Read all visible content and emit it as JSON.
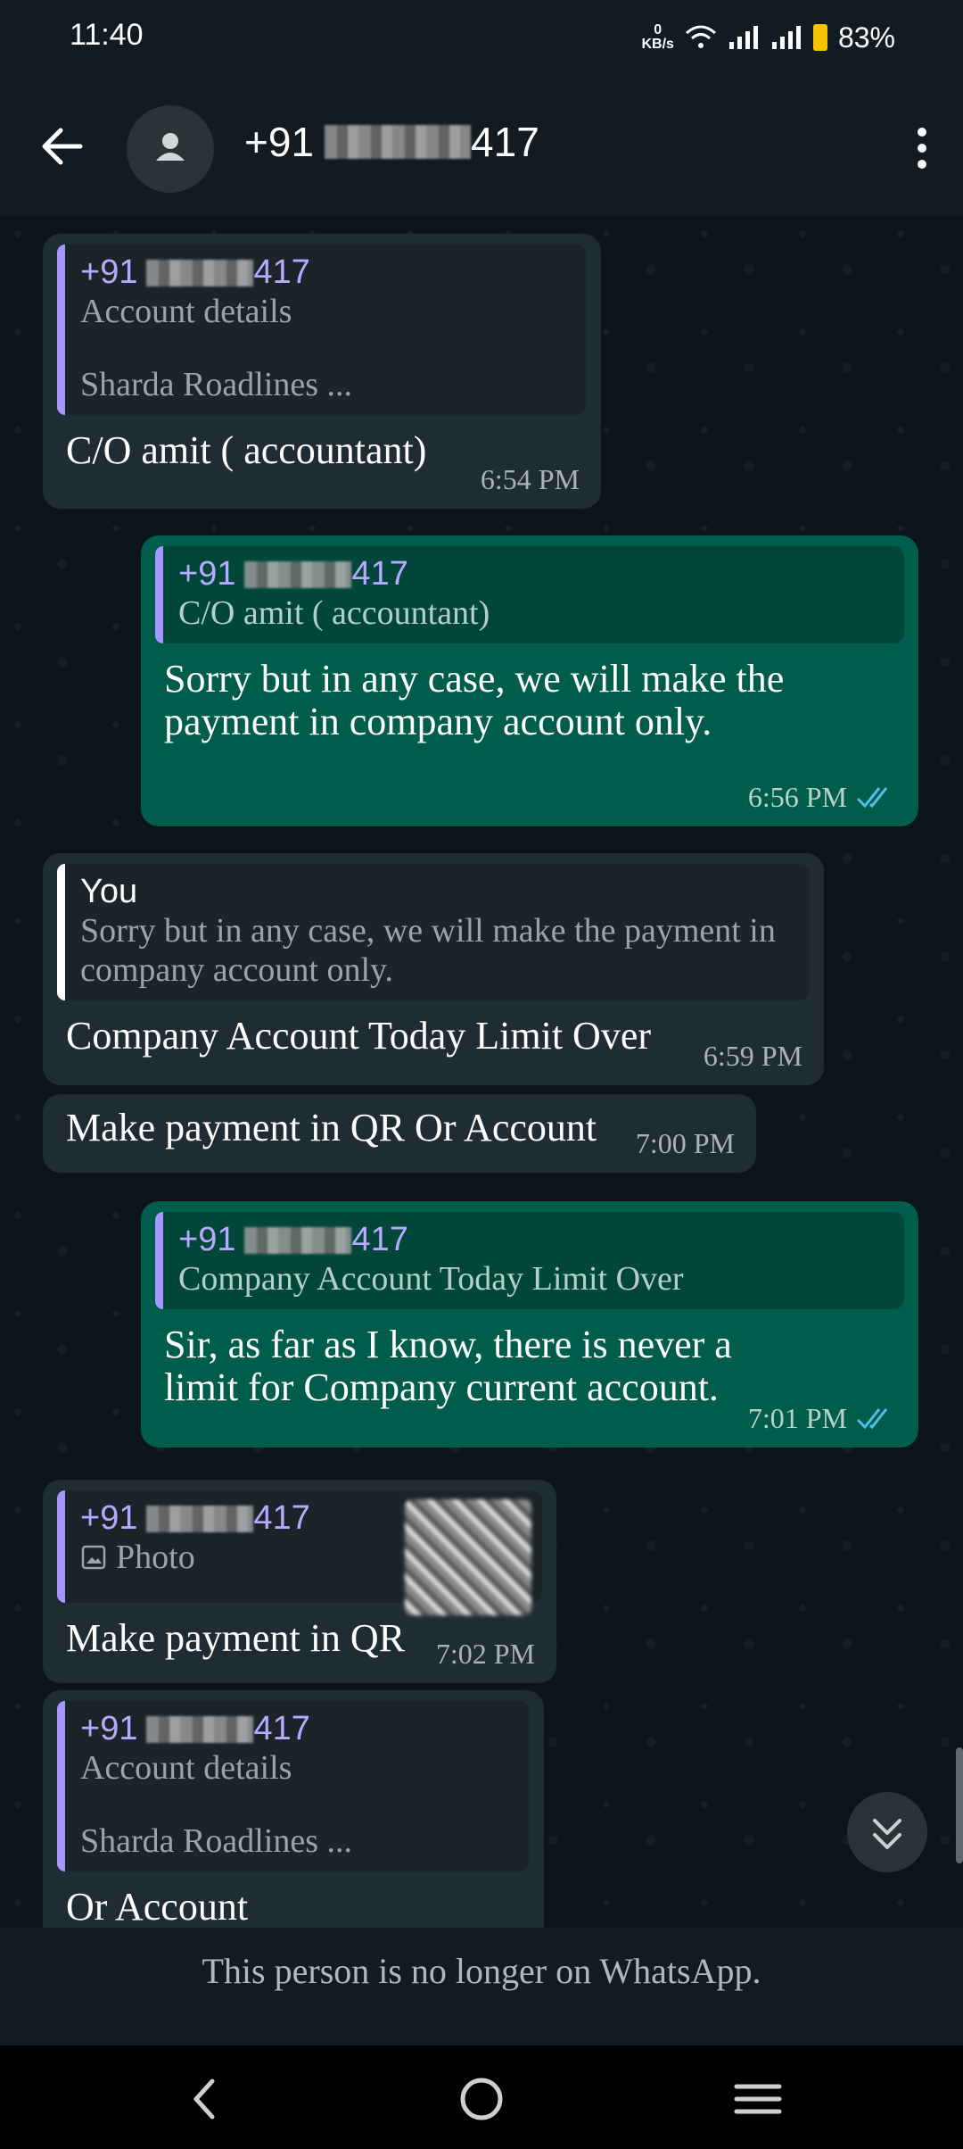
{
  "status": {
    "time": "11:40",
    "net_speed_value": "0",
    "net_speed_unit": "KB/s",
    "battery": "83%"
  },
  "header": {
    "prefix": "+91",
    "suffix": "417"
  },
  "messages": [
    {
      "quote_prefix": "+91",
      "quote_suffix": "417",
      "quote_line1": "Account details",
      "quote_line2": "Sharda Roadlines ...",
      "text": "C/O amit ( accountant)",
      "time": "6:54 PM"
    },
    {
      "quote_prefix": "+91",
      "quote_suffix": "417",
      "quote_line1": "C/O amit ( accountant)",
      "text": "Sorry but in any case, we will make the payment in company account only.",
      "time": "6:56 PM"
    },
    {
      "quote_author": "You",
      "quote_line1": "Sorry but in any case, we will make the payment in company account only.",
      "text": "Company Account Today Limit Over",
      "time": "6:59 PM"
    },
    {
      "text": "Make payment in QR Or Account",
      "time": "7:00 PM"
    },
    {
      "quote_prefix": "+91",
      "quote_suffix": "417",
      "quote_line1": "Company Account Today Limit Over",
      "text": "Sir, as far as I know, there is never a limit for Company current account.",
      "time": "7:01 PM"
    },
    {
      "quote_prefix": "+91",
      "quote_suffix": "417",
      "quote_line1": "Photo",
      "text": "Make payment in QR",
      "time": "7:02 PM"
    },
    {
      "quote_prefix": "+91",
      "quote_suffix": "417",
      "quote_line1": "Account details",
      "quote_line2": "Sharda Roadlines ...",
      "text": "Or Account"
    }
  ],
  "footer": {
    "notice": "This person is no longer on WhatsApp."
  },
  "colors": {
    "incoming": "#202c33",
    "outgoing": "#005c4b",
    "quote_bar": "#a796ff",
    "tick_blue": "#53bdeb"
  }
}
